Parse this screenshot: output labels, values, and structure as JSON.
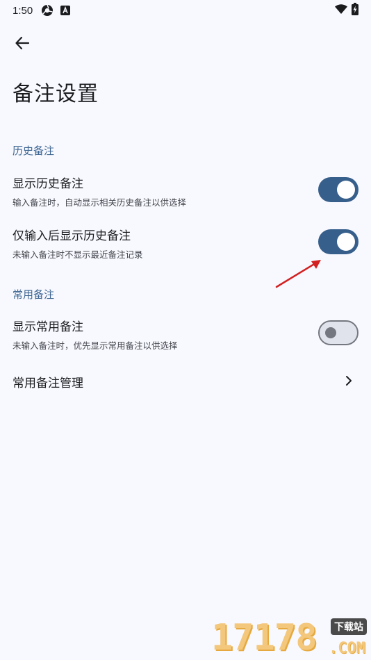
{
  "status_bar": {
    "time": "1:50",
    "left_icons": [
      "chromium-icon",
      "a-badge-icon"
    ],
    "right_icons": [
      "wifi-icon",
      "battery-charging-icon"
    ]
  },
  "header": {
    "back_icon": "arrow-left-icon",
    "title": "备注设置"
  },
  "sections": {
    "history": {
      "header": "历史备注",
      "show_history": {
        "title": "显示历史备注",
        "subtitle": "输入备注时，自动显示相关历史备注以供选择",
        "enabled": true
      },
      "only_after_input": {
        "title": "仅输入后显示历史备注",
        "subtitle": "未输入备注时不显示最近备注记录",
        "enabled": true
      }
    },
    "common": {
      "header": "常用备注",
      "show_common": {
        "title": "显示常用备注",
        "subtitle": "未输入备注时，优先显示常用备注以供选择",
        "enabled": false
      },
      "manage": {
        "title": "常用备注管理",
        "icon": "chevron-right-icon"
      }
    }
  },
  "watermark": {
    "digits": "17178",
    "badge": "下载站",
    "domain": ".COM"
  },
  "colors": {
    "background": "#f8f9ff",
    "accent": "#375f8b",
    "section_header": "#3d6592",
    "annotation_arrow": "#d32020"
  }
}
